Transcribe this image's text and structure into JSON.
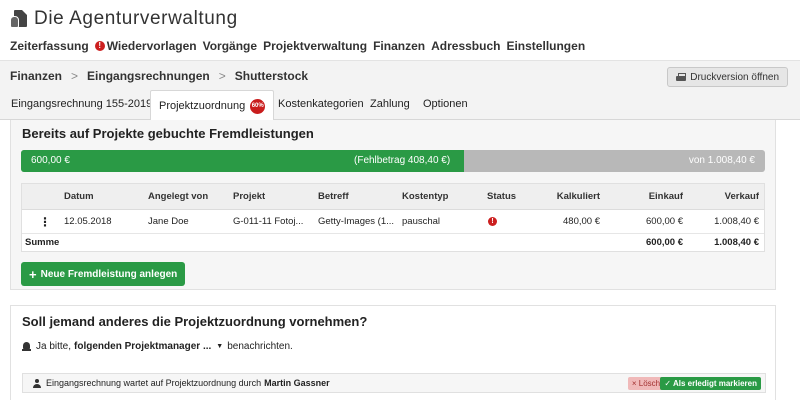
{
  "app": {
    "title": "Die Agenturverwaltung",
    "logo_icon": "agency-logo-icon"
  },
  "mainnav": [
    {
      "label": "Zeiterfassung"
    },
    {
      "label": "Wiedervorlagen",
      "alert": "!"
    },
    {
      "label": "Vorgänge"
    },
    {
      "label": "Projektverwaltung"
    },
    {
      "label": "Finanzen"
    },
    {
      "label": "Adressbuch"
    },
    {
      "label": "Einstellungen"
    }
  ],
  "breadcrumb": [
    "Finanzen",
    "Eingangsrechnungen",
    "Shutterstock"
  ],
  "breadcrumb_separator": ">",
  "print_button": "Druckversion öffnen",
  "tabs": [
    {
      "label": "Eingangsrechnung 155-2019"
    },
    {
      "label": "Projektzuordnung",
      "badge": "60%",
      "active": true
    },
    {
      "label": "Kostenkategorien"
    },
    {
      "label": "Zahlung"
    },
    {
      "label": "Optionen"
    }
  ],
  "booked_section": {
    "title": "Bereits auf Projekte gebuchte Fremdleistungen",
    "progress": {
      "fraction": 0.595,
      "booked_label": "600,00 €",
      "missing_label": "(Fehlbetrag 408,40 €)",
      "total_label": "von 1.008,40 €"
    },
    "table": {
      "columns": [
        "",
        "Datum",
        "Angelegt von",
        "Projekt",
        "Betreff",
        "Kostentyp",
        "Status",
        "Kalkuliert",
        "Einkauf",
        "Verkauf"
      ],
      "rows": [
        {
          "menu": "⋮",
          "datum": "12.05.2018",
          "angelegt_von": "Jane Doe",
          "projekt": "G-011-11 Fotoj...",
          "betreff": "Getty-Images (1...",
          "kostentyp": "pauschal",
          "status": "!",
          "kalkuliert": "480,00 €",
          "einkauf": "600,00 €",
          "verkauf": "1.008,40 €"
        }
      ],
      "summary": {
        "label": "Summe",
        "einkauf": "600,00 €",
        "verkauf": "1.008,40 €"
      }
    },
    "new_button": {
      "icon": "+",
      "label": "Neue Fremdleistung anlegen"
    }
  },
  "reassign_section": {
    "question": "Soll jemand anderes die Projektzuordnung vornehmen?",
    "notify_prefix": "Ja bitte,",
    "notify_select": "folgenden Projektmanager ...",
    "notify_suffix": "benachrichten.",
    "assignment": {
      "text": "Eingangsrechnung wartet auf Projektzuordnung durch",
      "person": "Martin Gassner",
      "delete_label": "× Löschen",
      "done_label": "✓ Als erledigt markieren"
    }
  },
  "colors": {
    "accent_green": "#2a9a45",
    "alert_red": "#cc1f1f",
    "progress_remaining": "#b8b8b8"
  }
}
